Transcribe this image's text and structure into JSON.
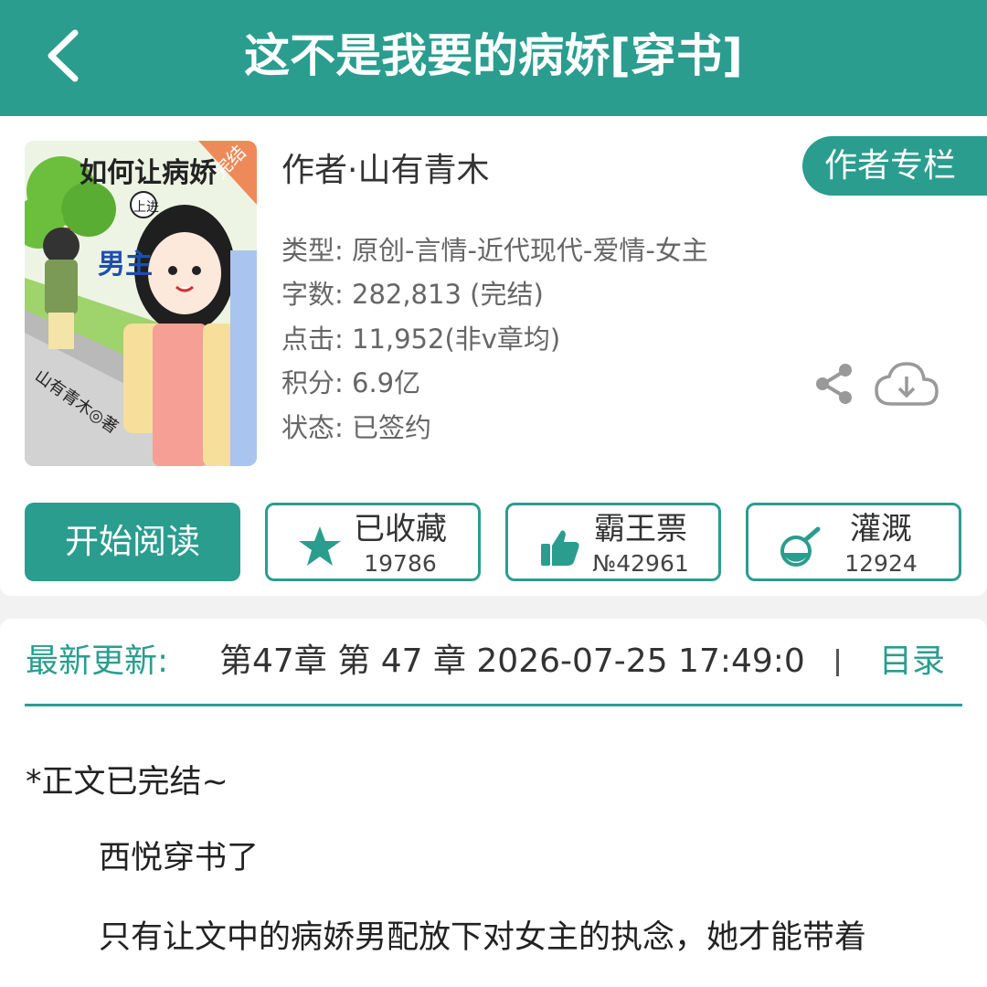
{
  "header": {
    "title": "这不是我要的病娇[穿书]"
  },
  "book": {
    "cover_title": "如何让病娇",
    "cover_volume": "上进",
    "cover_badge": "完结",
    "cover_tag": "男主",
    "cover_author": "山有青木◎著",
    "author_line": "作者·山有青木",
    "author_column_label": "作者专栏",
    "meta": [
      "类型: 原创-言情-近代现代-爱情-女主",
      "字数: 282,813 (完结)",
      "点击: 11,952(非v章均)",
      "积分: 6.9亿",
      "状态: 已签约"
    ]
  },
  "actions": {
    "read_label": "开始阅读",
    "collect": {
      "label": "已收藏",
      "value": "19786",
      "icon": "star-icon"
    },
    "vote": {
      "label": "霸王票",
      "value": "№42961",
      "icon": "thumbs-up-icon"
    },
    "water": {
      "label": "灌溉",
      "value": "12924",
      "icon": "flask-icon"
    }
  },
  "update": {
    "label": "最新更新:",
    "text": "第47章  第 47 章  2026-07-25 17:49:0",
    "toc_label": "目录"
  },
  "intro": {
    "line1": "*正文已完结~",
    "line2": "西悦穿书了",
    "line3": "只有让文中的病娇男配放下对女主的执念，她才能带着"
  },
  "colors": {
    "accent": "#2a9d8f",
    "background": "#f2f2f2"
  }
}
